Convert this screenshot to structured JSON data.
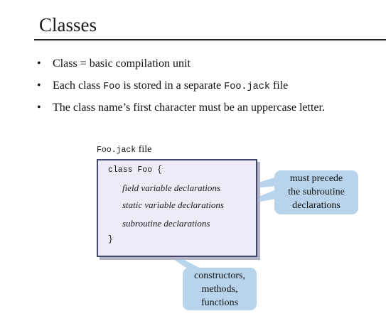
{
  "slide": {
    "title": "Classes",
    "bullets": [
      {
        "parts": [
          {
            "text": "Class = basic compilation unit",
            "mono": false
          }
        ]
      },
      {
        "parts": [
          {
            "text": "Each class ",
            "mono": false
          },
          {
            "text": "Foo",
            "mono": true
          },
          {
            "text": " is stored in a separate ",
            "mono": false
          },
          {
            "text": "Foo.jack",
            "mono": true
          },
          {
            "text": " file",
            "mono": false
          }
        ]
      },
      {
        "parts": [
          {
            "text": "The class name’s first character must be an uppercase letter.",
            "mono": false
          }
        ]
      }
    ],
    "bullet_symbol": "•"
  },
  "diagram": {
    "file_label_code": "Foo.jack",
    "file_label_text": " file",
    "code": {
      "open": "class Foo {",
      "field": "field variable declarations",
      "static": "static variable declarations",
      "subroutine": "subroutine declarations",
      "close": "}"
    },
    "callout_precede": [
      "must precede",
      "the subroutine",
      "declarations"
    ],
    "callout_subroutines": [
      "constructors,",
      "methods,",
      "functions"
    ]
  },
  "colors": {
    "code_background": "#ecebf7",
    "code_border": "#44466a",
    "callout_fill": "#b8d4ec"
  }
}
